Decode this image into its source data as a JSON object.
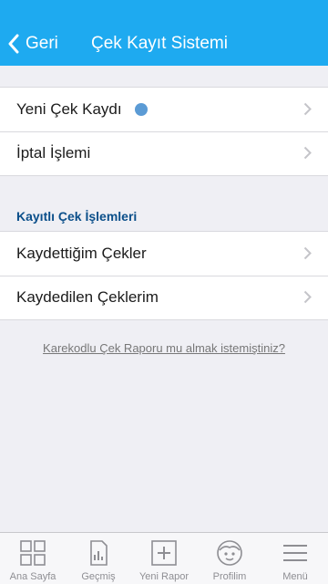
{
  "header": {
    "back_label": "Geri",
    "title": "Çek Kayıt Sistemi",
    "background": "#1eaaf0"
  },
  "top_group": {
    "items": [
      {
        "label": "Yeni Çek Kaydı",
        "indicator_color": "#5b9bd5"
      },
      {
        "label": "İptal İşlemi"
      }
    ]
  },
  "section": {
    "title": "Kayıtlı Çek İşlemleri",
    "items": [
      {
        "label": "Kaydettiğim Çekler"
      },
      {
        "label": "Kaydedilen Çeklerim"
      }
    ]
  },
  "footer_link": "Karekodlu Çek Raporu mu almak istemiştiniz?",
  "tabbar": {
    "tabs": [
      {
        "label": "Ana Sayfa",
        "icon": "grid-icon"
      },
      {
        "label": "Geçmiş",
        "icon": "history-icon"
      },
      {
        "label": "Yeni Rapor",
        "icon": "plus-box-icon"
      },
      {
        "label": "Profilim",
        "icon": "face-icon"
      },
      {
        "label": "Menü",
        "icon": "hamburger-icon"
      }
    ]
  }
}
